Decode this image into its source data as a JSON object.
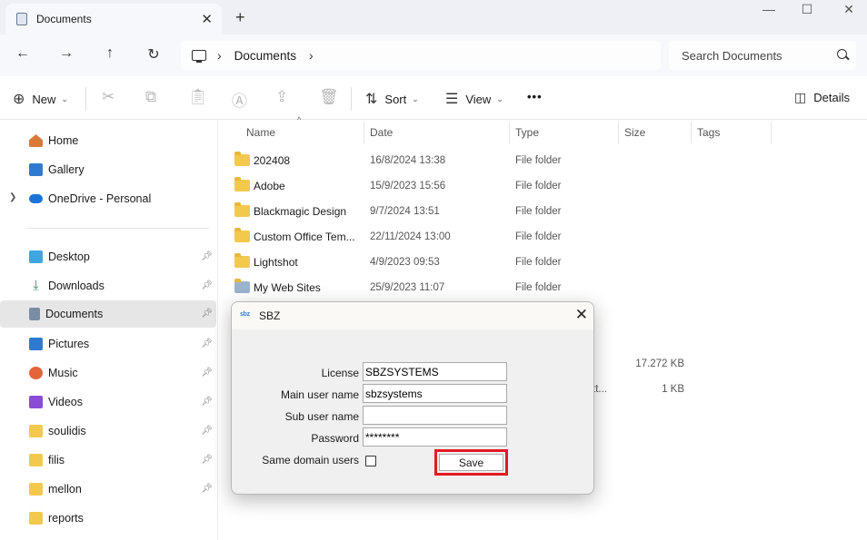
{
  "window": {
    "tab_title": "Documents",
    "tab_close": "✕",
    "new_tab": "+",
    "minimize": "—",
    "maximize": "☐",
    "close": "✕"
  },
  "address": {
    "breadcrumb": [
      "Documents"
    ],
    "search_placeholder": "Search Documents"
  },
  "toolbar": {
    "new_label": "New",
    "sort_label": "Sort",
    "view_label": "View",
    "more_label": "•••",
    "details_label": "Details"
  },
  "sidebar": {
    "top": [
      {
        "label": "Home",
        "icon": "home-icon",
        "color": "#d8793a"
      },
      {
        "label": "Gallery",
        "icon": "gallery-icon",
        "color": "#2f7ad1"
      },
      {
        "label": "OneDrive - Personal",
        "icon": "onedrive-icon",
        "color": "#1b74d4"
      }
    ],
    "pinned": [
      {
        "label": "Desktop",
        "icon": "desktop-icon",
        "color": "#3ea7e0"
      },
      {
        "label": "Downloads",
        "icon": "downloads-icon",
        "color": "#2c9a6a"
      },
      {
        "label": "Documents",
        "icon": "documents-icon",
        "color": "#7b8da6"
      },
      {
        "label": "Pictures",
        "icon": "pictures-icon",
        "color": "#2f7ad1"
      },
      {
        "label": "Music",
        "icon": "music-icon",
        "color": "#e4643a"
      },
      {
        "label": "Videos",
        "icon": "videos-icon",
        "color": "#8a4bd6"
      },
      {
        "label": "soulidis",
        "icon": "folder-icon",
        "color": "#f2c94c"
      },
      {
        "label": "filis",
        "icon": "folder-icon",
        "color": "#f2c94c"
      },
      {
        "label": "mellon",
        "icon": "folder-icon",
        "color": "#f2c94c"
      },
      {
        "label": "reports",
        "icon": "folder-icon",
        "color": "#f2c94c"
      }
    ],
    "selected": "Documents"
  },
  "files": {
    "columns": [
      "Name",
      "Date",
      "Type",
      "Size",
      "Tags"
    ],
    "rows": [
      {
        "name": "202408",
        "date": "16/8/2024 13:38",
        "type": "File folder",
        "size": ""
      },
      {
        "name": "Adobe",
        "date": "15/9/2023 15:56",
        "type": "File folder",
        "size": ""
      },
      {
        "name": "Blackmagic Design",
        "date": "9/7/2024 13:51",
        "type": "File folder",
        "size": ""
      },
      {
        "name": "Custom Office Tem...",
        "date": "22/11/2024 13:00",
        "type": "File folder",
        "size": ""
      },
      {
        "name": "Lightshot",
        "date": "4/9/2023 09:53",
        "type": "File folder",
        "size": ""
      },
      {
        "name": "My Web Sites",
        "date": "25/9/2023 11:07",
        "type": "File folder",
        "size": ""
      }
    ],
    "partial_rows": [
      {
        "size": "17.272 KB",
        "type_fragment": ""
      },
      {
        "size": "1 KB",
        "type_fragment": "tt..."
      }
    ]
  },
  "dialog": {
    "logo": "sbz",
    "title": "SBZ",
    "close": "✕",
    "fields": [
      {
        "label": "License",
        "value": "SBZSYSTEMS"
      },
      {
        "label": "Main user name",
        "value": "sbzsystems"
      },
      {
        "label": "Sub user name",
        "value": ""
      },
      {
        "label": "Password",
        "value": "********"
      }
    ],
    "checkbox_label": "Same domain users",
    "checkbox_checked": false,
    "save_label": "Save",
    "highlight_color": "#e41a23"
  }
}
